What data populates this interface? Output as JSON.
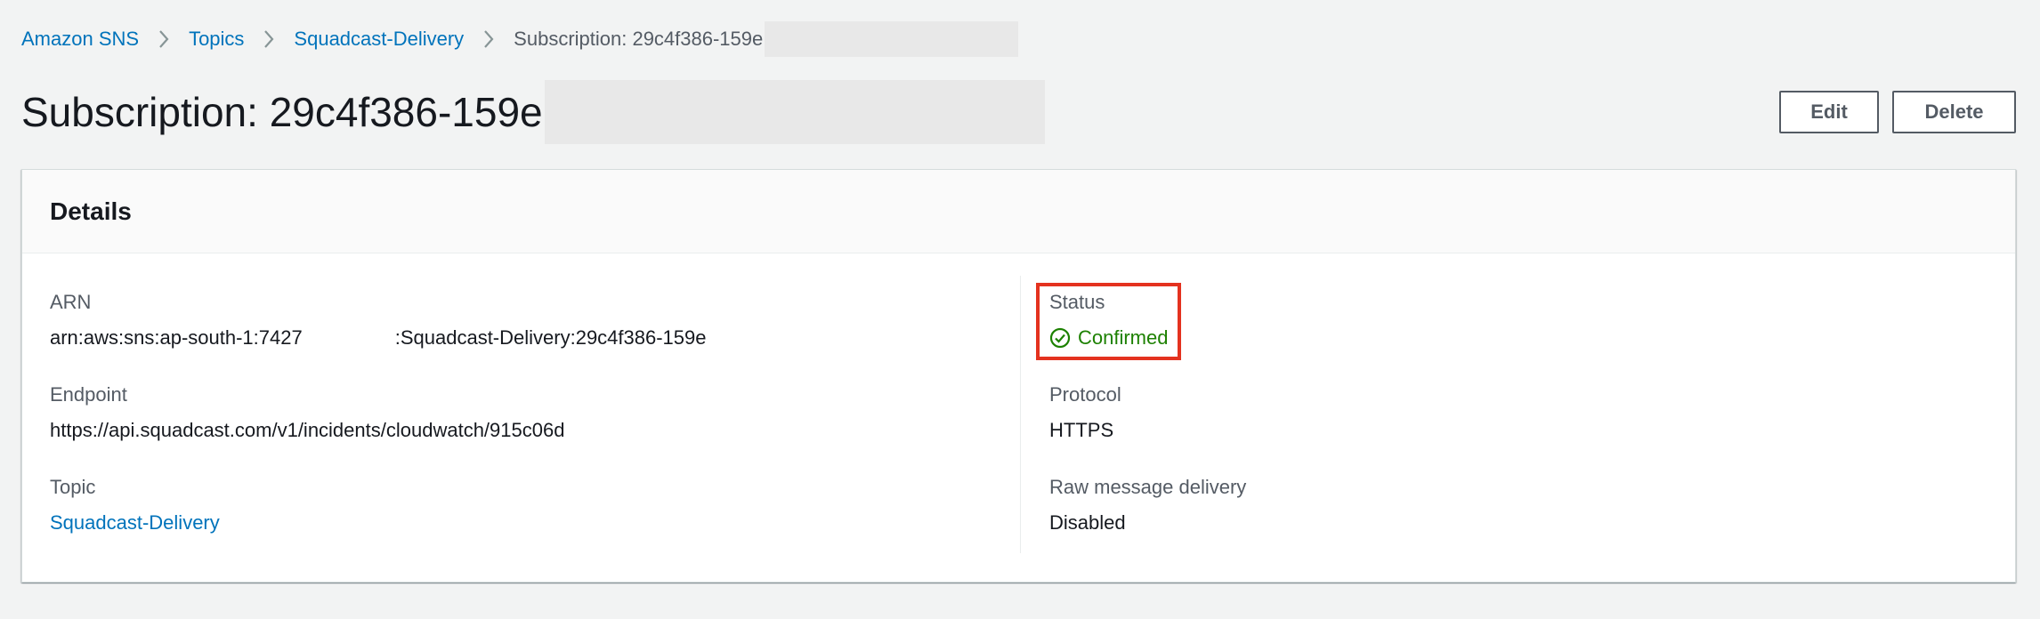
{
  "breadcrumb": {
    "items": [
      "Amazon SNS",
      "Topics",
      "Squadcast-Delivery"
    ],
    "current": "Subscription: 29c4f386-159e"
  },
  "header": {
    "title": "Subscription: 29c4f386-159e",
    "edit_label": "Edit",
    "delete_label": "Delete"
  },
  "details": {
    "title": "Details",
    "arn_label": "ARN",
    "arn_value_start": "arn:aws:sns:ap-south-1:7427",
    "arn_value_end": ":Squadcast-Delivery:29c4f386-159e",
    "endpoint_label": "Endpoint",
    "endpoint_value": "https://api.squadcast.com/v1/incidents/cloudwatch/915c06d",
    "topic_label": "Topic",
    "topic_value": "Squadcast-Delivery",
    "status_label": "Status",
    "status_value": "Confirmed",
    "protocol_label": "Protocol",
    "protocol_value": "HTTPS",
    "raw_label": "Raw message delivery",
    "raw_value": "Disabled"
  },
  "icons": {
    "breadcrumb_separator": "chevron-right-icon",
    "status": "check-circle-icon"
  },
  "colors": {
    "link": "#0073bb",
    "success": "#1d8102",
    "highlight": "#e4321f",
    "background": "#f2f3f3"
  }
}
